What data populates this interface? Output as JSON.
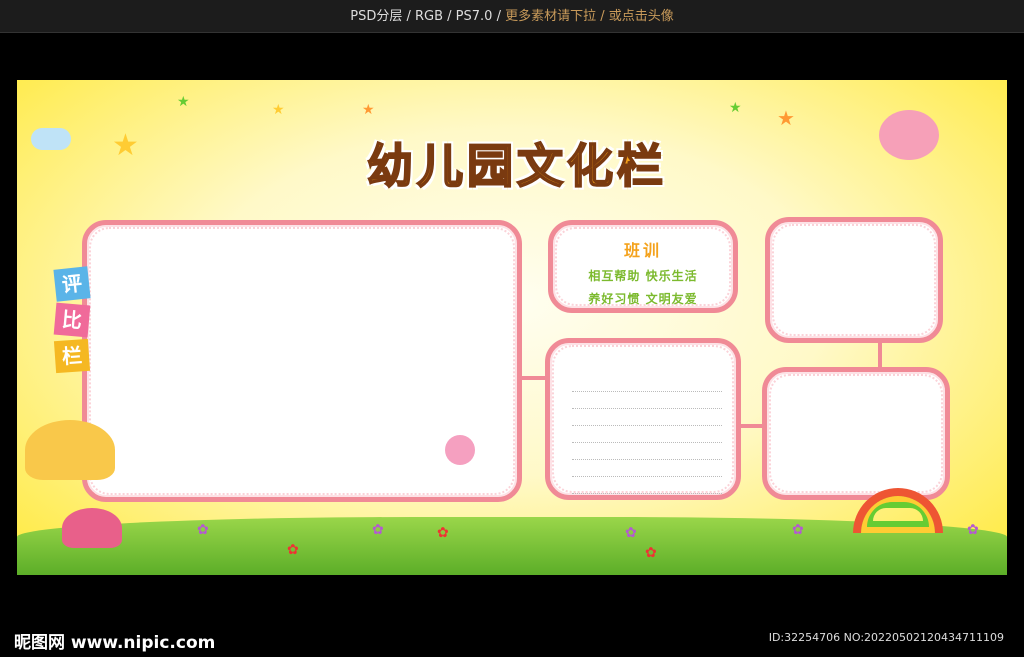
{
  "header": {
    "specs": "PSD分层 / RGB / PS7.0 / ",
    "hint": "更多素材请下拉 / 或点击头像"
  },
  "poster": {
    "title": "幼儿园文化栏",
    "side_label": [
      "评",
      "比",
      "栏"
    ],
    "side_label_colors": [
      "#5ab4e8",
      "#f06a9a",
      "#f5b822"
    ],
    "motto": {
      "heading": "班训",
      "lines": [
        "相互帮助 快乐生活",
        "养好习惯 文明友爱"
      ]
    },
    "accent": "#f08a96"
  },
  "footer": {
    "logo": "昵图网 www.nipic.com",
    "id": "ID:32254706 NO:20220502120434711109"
  }
}
